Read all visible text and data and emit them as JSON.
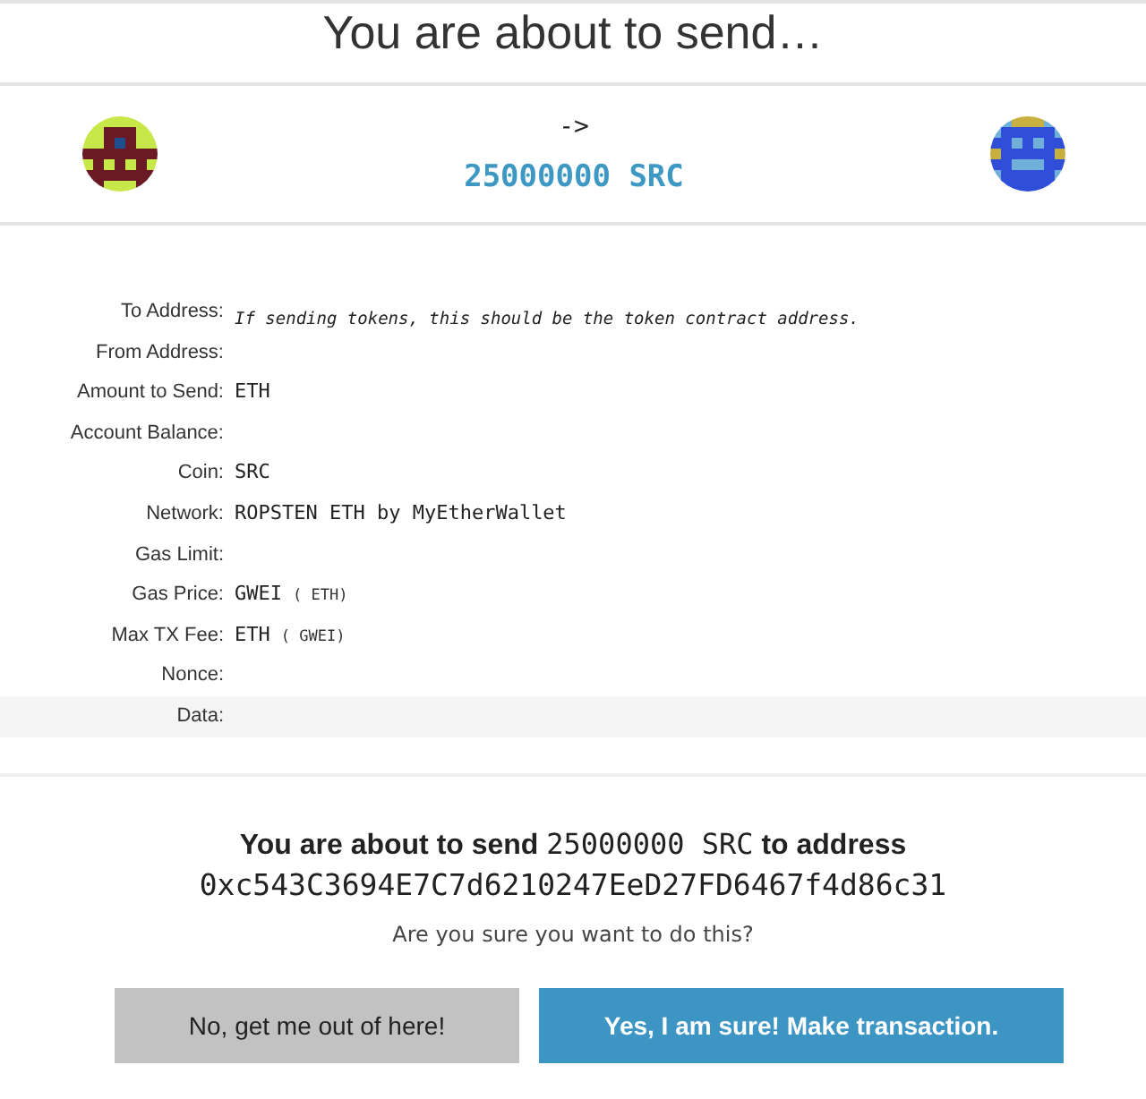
{
  "title": "You are about to send…",
  "transfer": {
    "arrow": "->",
    "amount": "25000000 SRC"
  },
  "details": [
    {
      "label": "To Address:",
      "value": "If sending tokens, this should be the token contract address.",
      "kind": "hint"
    },
    {
      "label": "From Address:"
    },
    {
      "label": "Amount to Send:",
      "value": "ETH"
    },
    {
      "label": "Account Balance:"
    },
    {
      "label": "Coin:",
      "value": "SRC"
    },
    {
      "label": "Network:",
      "value": "ROPSTEN ETH by MyEtherWallet"
    },
    {
      "label": "Gas Limit:"
    },
    {
      "label": "Gas Price:",
      "value": "GWEI",
      "note": "( ETH)"
    },
    {
      "label": "Max TX Fee:",
      "value": "ETH",
      "note": "( GWEI)"
    },
    {
      "label": "Nonce:"
    },
    {
      "label": "Data:",
      "kind": "shaded"
    }
  ],
  "confirm": {
    "lead": "You are about to send",
    "amount": "25000000 SRC",
    "mid": "to address",
    "address": "0xc543C3694E7C7d6210247EeD27FD6467f4d86c31",
    "question": "Are you sure you want to do this?"
  },
  "buttons": [
    {
      "label": "No, get me out of here!",
      "kind": "cancel"
    },
    {
      "label": "Yes, I am sure! Make transaction.",
      "kind": "primary"
    }
  ]
}
